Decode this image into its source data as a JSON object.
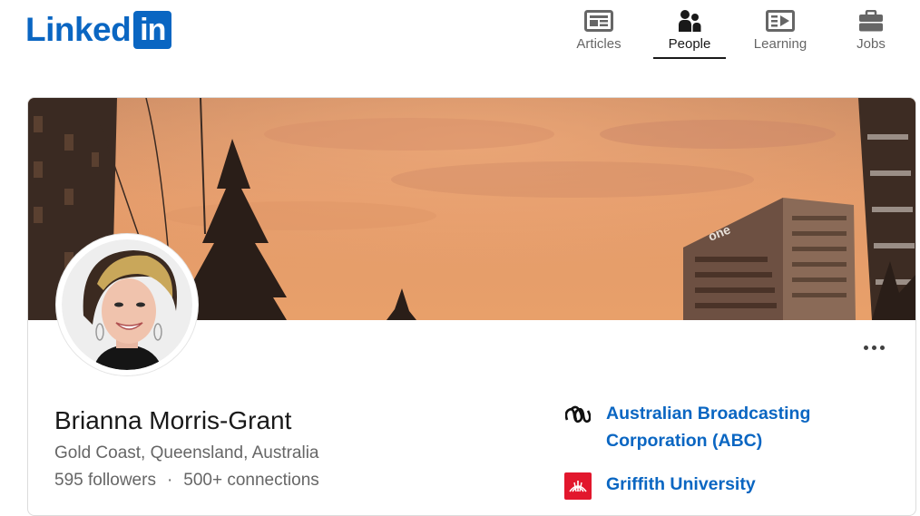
{
  "header": {
    "logo_text": "Linked",
    "logo_box_text": "in",
    "nav": [
      {
        "label": "Articles",
        "icon": "articles-icon",
        "active": false
      },
      {
        "label": "People",
        "icon": "people-icon",
        "active": true
      },
      {
        "label": "Learning",
        "icon": "learning-icon",
        "active": false
      },
      {
        "label": "Jobs",
        "icon": "jobs-icon",
        "active": false
      }
    ]
  },
  "profile": {
    "name": "Brianna Morris-Grant",
    "location": "Gold Coast, Queensland, Australia",
    "followers": "595 followers",
    "separator": "·",
    "connections": "500+ connections",
    "cover_building_sign": "one"
  },
  "organizations": [
    {
      "name": "Australian Broadcasting Corporation (ABC)",
      "logo": "abc-logo-icon"
    },
    {
      "name": "Griffith University",
      "logo": "griffith-logo-icon"
    }
  ],
  "colors": {
    "brand": "#0a66c2",
    "sky": "#e09a68",
    "griffith_red": "#e2172d"
  }
}
